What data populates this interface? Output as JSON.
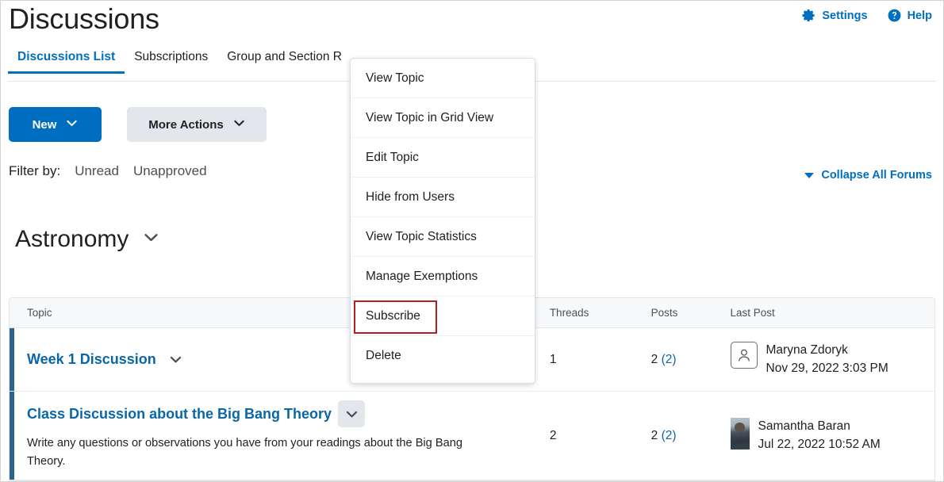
{
  "header": {
    "title": "Discussions",
    "actions": [
      {
        "label": "Settings",
        "icon": "gear-icon"
      },
      {
        "label": "Help",
        "icon": "help-circle-icon"
      }
    ]
  },
  "tabs": [
    {
      "label": "Discussions List",
      "active": true
    },
    {
      "label": "Subscriptions",
      "active": false
    },
    {
      "label": "Group and Section R",
      "active": false
    }
  ],
  "toolbar": {
    "new_label": "New",
    "more_actions_label": "More Actions"
  },
  "filter": {
    "label": "Filter by:",
    "options": [
      "Unread",
      "Unapproved"
    ]
  },
  "collapse_all": {
    "label": "Collapse All Forums",
    "icon": "triangle-down-icon"
  },
  "forum": {
    "name": "Astronomy",
    "chevron_icon": "chevron-down-icon"
  },
  "table": {
    "columns": [
      "Topic",
      "Threads",
      "Posts",
      "Last Post"
    ],
    "rows": [
      {
        "topic": "Week 1 Discussion",
        "description": "",
        "threads": "1",
        "posts_total": "2",
        "posts_unread": "(2)",
        "last_post_name": "Maryna Zdoryk",
        "last_post_date": "Nov 29, 2022 3:03 PM",
        "avatar_type": "placeholder",
        "chevron_focused": false
      },
      {
        "topic": "Class Discussion about the Big Bang Theory",
        "description": "Write any questions or observations you have from your readings about the Big Bang Theory.",
        "threads": "2",
        "posts_total": "2",
        "posts_unread": "(2)",
        "last_post_name": "Samantha Baran",
        "last_post_date": "Jul 22, 2022 10:52 AM",
        "avatar_type": "photo",
        "chevron_focused": true
      }
    ]
  },
  "context_menu": {
    "items": [
      {
        "label": "View Topic",
        "highlighted": false
      },
      {
        "label": "View Topic in Grid View",
        "highlighted": false
      },
      {
        "label": "Edit Topic",
        "highlighted": false
      },
      {
        "label": "Hide from Users",
        "highlighted": false
      },
      {
        "label": "View Topic Statistics",
        "highlighted": false
      },
      {
        "label": "Manage Exemptions",
        "highlighted": false
      },
      {
        "label": "Subscribe",
        "highlighted": true
      },
      {
        "label": "Delete",
        "highlighted": false
      }
    ]
  },
  "colors": {
    "link_blue": "#006fbf",
    "primary_button": "#006ec0",
    "row_accent": "#2c6589",
    "highlight_red": "#b41f24"
  }
}
